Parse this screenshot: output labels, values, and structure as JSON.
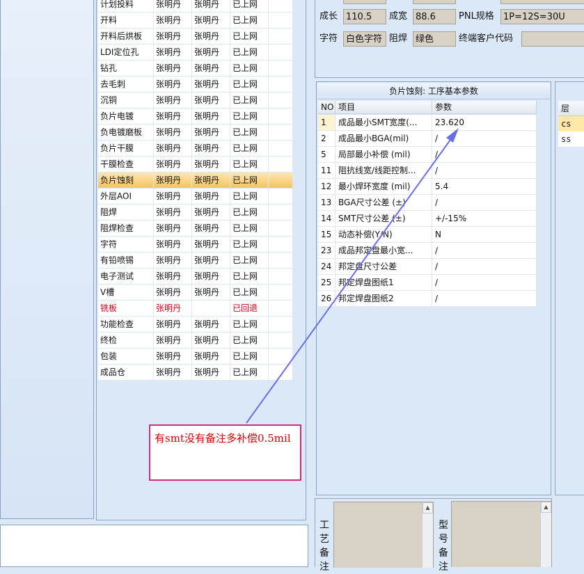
{
  "process_list": {
    "rows": [
      {
        "step": "计划投料",
        "op": "张明丹",
        "chk": "张明丹",
        "status": "已上网"
      },
      {
        "step": "开料",
        "op": "张明丹",
        "chk": "张明丹",
        "status": "已上网"
      },
      {
        "step": "开料后烘板",
        "op": "张明丹",
        "chk": "张明丹",
        "status": "已上网"
      },
      {
        "step": "LDI定位孔",
        "op": "张明丹",
        "chk": "张明丹",
        "status": "已上网"
      },
      {
        "step": "钻孔",
        "op": "张明丹",
        "chk": "张明丹",
        "status": "已上网"
      },
      {
        "step": "去毛刺",
        "op": "张明丹",
        "chk": "张明丹",
        "status": "已上网"
      },
      {
        "step": "沉铜",
        "op": "张明丹",
        "chk": "张明丹",
        "status": "已上网"
      },
      {
        "step": "负片电镀",
        "op": "张明丹",
        "chk": "张明丹",
        "status": "已上网"
      },
      {
        "step": "负电镀磨板",
        "op": "张明丹",
        "chk": "张明丹",
        "status": "已上网"
      },
      {
        "step": "负片干膜",
        "op": "张明丹",
        "chk": "张明丹",
        "status": "已上网"
      },
      {
        "step": "干膜检查",
        "op": "张明丹",
        "chk": "张明丹",
        "status": "已上网"
      },
      {
        "step": "负片蚀刻",
        "op": "张明丹",
        "chk": "张明丹",
        "status": "已上网"
      },
      {
        "step": "外层AOI",
        "op": "张明丹",
        "chk": "张明丹",
        "status": "已上网"
      },
      {
        "step": "阻焊",
        "op": "张明丹",
        "chk": "张明丹",
        "status": "已上网"
      },
      {
        "step": "阻焊检查",
        "op": "张明丹",
        "chk": "张明丹",
        "status": "已上网"
      },
      {
        "step": "字符",
        "op": "张明丹",
        "chk": "张明丹",
        "status": "已上网"
      },
      {
        "step": "有铅喷锡",
        "op": "张明丹",
        "chk": "张明丹",
        "status": "已上网"
      },
      {
        "step": "电子测试",
        "op": "张明丹",
        "chk": "张明丹",
        "status": "已上网"
      },
      {
        "step": "V槽",
        "op": "张明丹",
        "chk": "张明丹",
        "status": "已上网"
      },
      {
        "step": "铣板",
        "op": "张明丹",
        "chk": "",
        "status": "已回退"
      },
      {
        "step": "功能检查",
        "op": "张明丹",
        "chk": "张明丹",
        "status": "已上网"
      },
      {
        "step": "终检",
        "op": "张明丹",
        "chk": "张明丹",
        "status": "已上网"
      },
      {
        "step": "包装",
        "op": "张明丹",
        "chk": "张明丹",
        "status": "已上网"
      },
      {
        "step": "成品仓",
        "op": "张明丹",
        "chk": "张明丹",
        "status": "已上网"
      }
    ]
  },
  "info": {
    "growth_label": "成长",
    "growth_value": "110.5",
    "width_label": "成宽",
    "width_value": "88.6",
    "pnl_label": "PNL规格",
    "pnl_value": "1P=12S=30U",
    "char_label": "字符",
    "char_value": "白色字符",
    "mask_label": "阻焊",
    "mask_value": "绿色",
    "customer_label": "终端客户代码",
    "customer_value": ""
  },
  "params": {
    "title": "负片蚀刻: 工序基本参数",
    "headers": {
      "no": "NO",
      "item": "项目",
      "value": "参数"
    },
    "rows": [
      {
        "no": "1",
        "item": "成品最小SMT宽度(...",
        "value": "23.620"
      },
      {
        "no": "2",
        "item": "成品最小BGA(mil)",
        "value": "/"
      },
      {
        "no": "5",
        "item": "局部最小补偿 (mil)",
        "value": "/"
      },
      {
        "no": "11",
        "item": "阻抗线宽/线距控制...",
        "value": "/"
      },
      {
        "no": "12",
        "item": "最小焊环宽度 (mil)",
        "value": "5.4"
      },
      {
        "no": "13",
        "item": "BGA尺寸公差 (±)",
        "value": "/"
      },
      {
        "no": "14",
        "item": "SMT尺寸公差 (±)",
        "value": "+/-15%"
      },
      {
        "no": "15",
        "item": "动态补偿(Y/N)",
        "value": "N"
      },
      {
        "no": "23",
        "item": "成品邦定盘最小宽...",
        "value": "/"
      },
      {
        "no": "24",
        "item": "邦定盘尺寸公差",
        "value": "/"
      },
      {
        "no": "25",
        "item": "邦定焊盘图纸1",
        "value": "/"
      },
      {
        "no": "26",
        "item": "邦定焊盘图纸2",
        "value": "/"
      }
    ]
  },
  "layers": {
    "header": "层",
    "rows": [
      "cs",
      "ss"
    ]
  },
  "remarks": {
    "process_label": [
      "工",
      "艺",
      "备",
      "注"
    ],
    "type_label": [
      "型",
      "号",
      "备",
      "注"
    ]
  },
  "annotation": {
    "text": "有smt没有备注多补偿0.5mil",
    "border_color": "#d4287c",
    "text_color": "#d00000",
    "arrow_color": "#6a6ee0"
  },
  "colors": {
    "selected_row": "#f8c460",
    "returned_status": "#d0001a"
  }
}
